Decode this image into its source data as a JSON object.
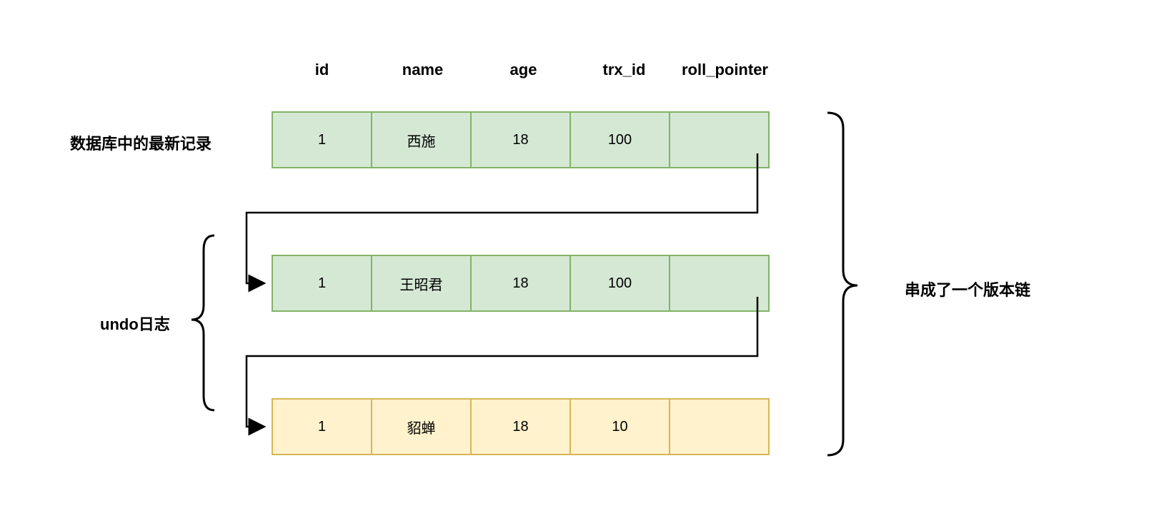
{
  "headers": [
    "id",
    "name",
    "age",
    "trx_id",
    "roll_pointer"
  ],
  "rows": [
    {
      "tone": "green",
      "cells": [
        "1",
        "西施",
        "18",
        "100",
        ""
      ]
    },
    {
      "tone": "green",
      "cells": [
        "1",
        "王昭君",
        "18",
        "100",
        ""
      ]
    },
    {
      "tone": "yellow",
      "cells": [
        "1",
        "貂蝉",
        "18",
        "10",
        ""
      ]
    }
  ],
  "labels": {
    "latest": "数据库中的最新记录",
    "undo": "undo日志",
    "chain": "串成了一个版本链"
  },
  "chart_data": {
    "type": "table",
    "title": "",
    "columns": [
      "id",
      "name",
      "age",
      "trx_id",
      "roll_pointer"
    ],
    "records": [
      {
        "id": 1,
        "name": "西施",
        "age": 18,
        "trx_id": 100,
        "roll_pointer": "→"
      },
      {
        "id": 1,
        "name": "王昭君",
        "age": 18,
        "trx_id": 100,
        "roll_pointer": "→"
      },
      {
        "id": 1,
        "name": "貂蝉",
        "age": 18,
        "trx_id": 10,
        "roll_pointer": ""
      }
    ],
    "annotations": {
      "latest_record_label": "数据库中的最新记录",
      "undo_log_label": "undo日志",
      "version_chain_label": "串成了一个版本链"
    }
  }
}
